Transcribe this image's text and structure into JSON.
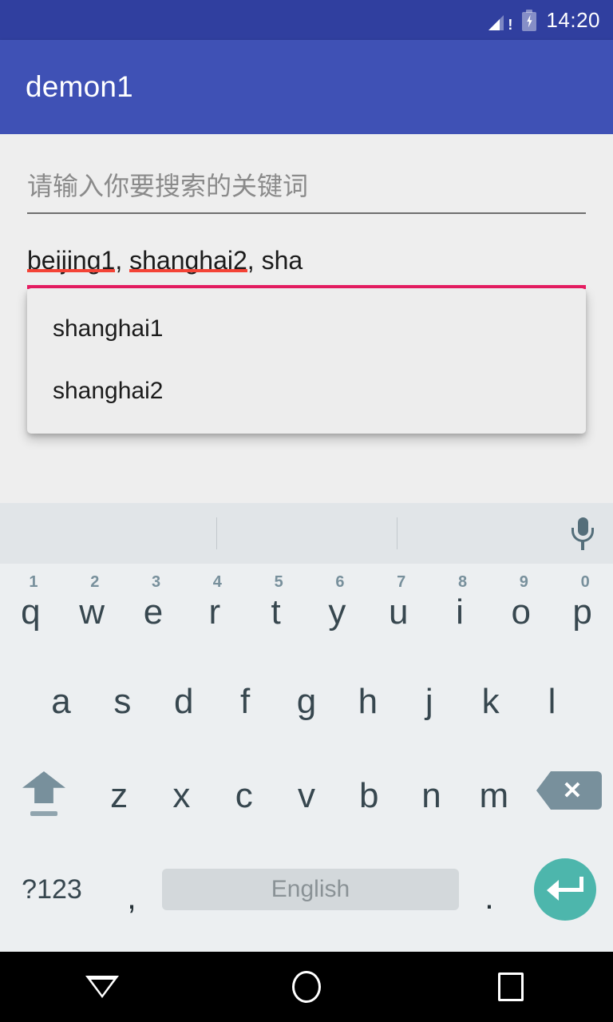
{
  "status_bar": {
    "time": "14:20",
    "signal_icon": "signal-bars-warning-icon",
    "battery_icon": "battery-charging-icon",
    "background_color": "#303F9F"
  },
  "app_bar": {
    "title": "demon1",
    "background_color": "#3F51B5",
    "text_color": "#FFFFFF"
  },
  "content": {
    "background_color": "#EEEEEE",
    "search_field": {
      "value": "",
      "placeholder": "请输入你要搜索的关键词",
      "underline_color": "#6E6E6E"
    },
    "result_field": {
      "text_part_1": "beijing1",
      "separator_1": ", ",
      "text_part_2": "shanghai2",
      "separator_2": ", ",
      "text_part_3": "sha",
      "full_value": "beijing1, shanghai2, sha",
      "underline_color": "#E91E63",
      "spellcheck_color": "#F44336"
    }
  },
  "dropdown": {
    "background_color": "#EDEDED",
    "items": [
      {
        "label": "shanghai1"
      },
      {
        "label": "shanghai2"
      }
    ]
  },
  "keyboard": {
    "background_color": "#ECEFF1",
    "suggestion_strip": {
      "background_color": "#E1E5E8",
      "mic_icon": "microphone-icon",
      "suggestions": [
        "",
        "",
        ""
      ]
    },
    "row1": [
      {
        "letter": "q",
        "number": "1"
      },
      {
        "letter": "w",
        "number": "2"
      },
      {
        "letter": "e",
        "number": "3"
      },
      {
        "letter": "r",
        "number": "4"
      },
      {
        "letter": "t",
        "number": "5"
      },
      {
        "letter": "y",
        "number": "6"
      },
      {
        "letter": "u",
        "number": "7"
      },
      {
        "letter": "i",
        "number": "8"
      },
      {
        "letter": "o",
        "number": "9"
      },
      {
        "letter": "p",
        "number": "0"
      }
    ],
    "row2": [
      {
        "letter": "a"
      },
      {
        "letter": "s"
      },
      {
        "letter": "d"
      },
      {
        "letter": "f"
      },
      {
        "letter": "g"
      },
      {
        "letter": "h"
      },
      {
        "letter": "j"
      },
      {
        "letter": "k"
      },
      {
        "letter": "l"
      }
    ],
    "row3": {
      "shift_icon": "shift-arrow-icon",
      "letters": [
        {
          "letter": "z"
        },
        {
          "letter": "x"
        },
        {
          "letter": "c"
        },
        {
          "letter": "v"
        },
        {
          "letter": "b"
        },
        {
          "letter": "n"
        },
        {
          "letter": "m"
        }
      ],
      "backspace_icon": "backspace-delete-icon"
    },
    "row4": {
      "symbols_label": "?123",
      "comma_label": ",",
      "space_label": "English",
      "period_label": ".",
      "enter_icon": "enter-return-icon",
      "enter_color": "#4DB6AC"
    }
  },
  "nav_bar": {
    "background_color": "#000000",
    "back_icon": "nav-back-triangle-icon",
    "home_icon": "nav-home-circle-icon",
    "recents_icon": "nav-recents-square-icon"
  }
}
